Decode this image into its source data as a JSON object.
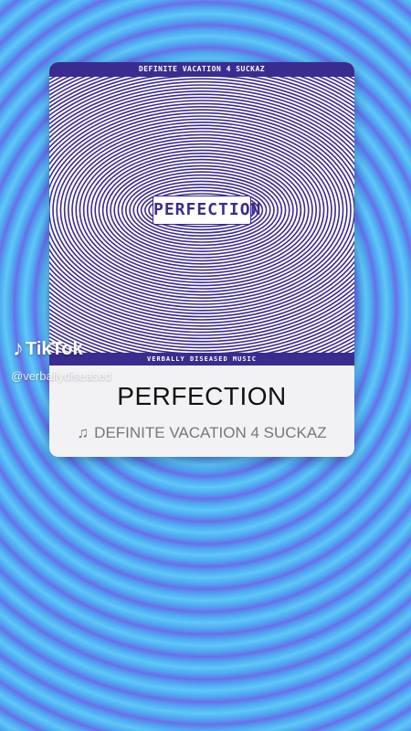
{
  "album": {
    "top_label": "DEFINITE VACATION 4 SUCKAZ",
    "art_title": "PERFECTION",
    "bottom_label": "VERBALLY DISEASED MUSIC"
  },
  "track": {
    "title": "PERFECTION",
    "note_icon": "music-note-icon",
    "subtitle": "DEFINITE VACATION 4 SUCKAZ"
  },
  "watermark": {
    "logo_text": "TikTok",
    "handle": "@verballydiseased"
  },
  "colors": {
    "accent": "#3a2c8f",
    "background_light": "#5fc8f5",
    "background_mid": "#4fa6f2",
    "background_violet": "#6a6fe8"
  }
}
